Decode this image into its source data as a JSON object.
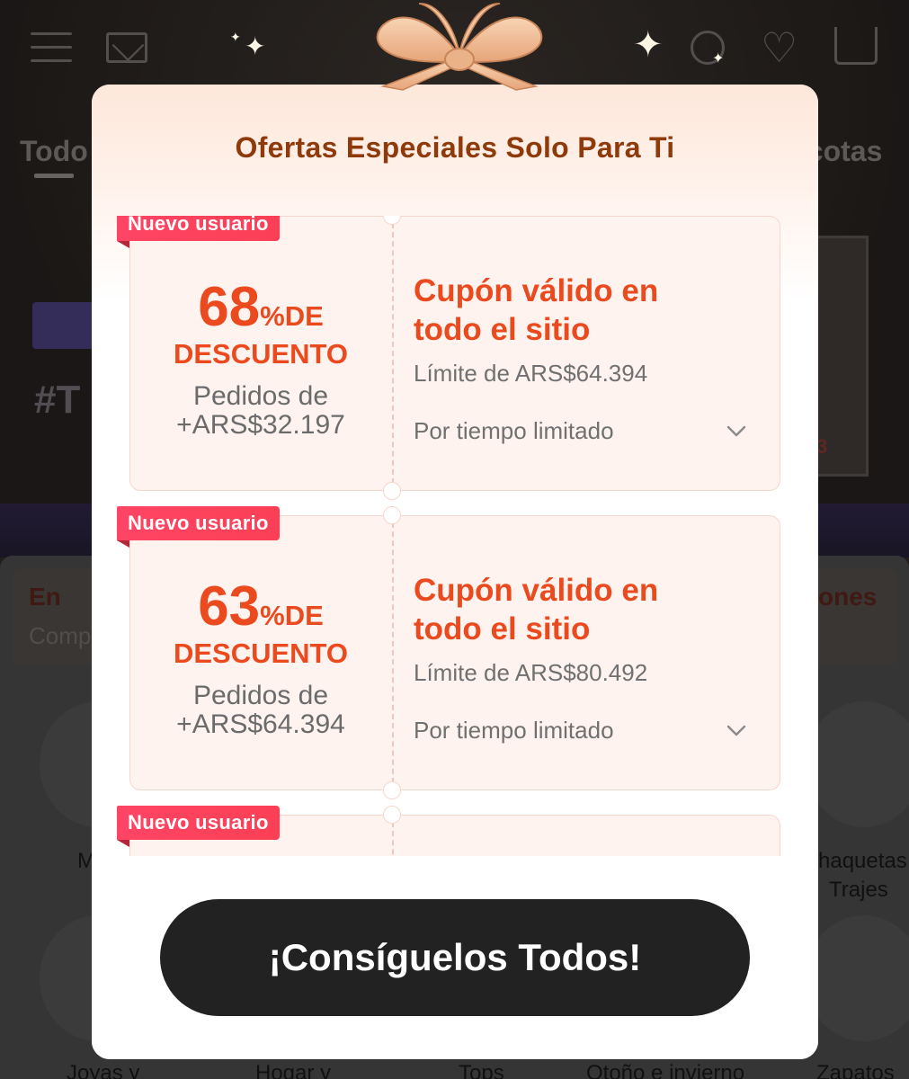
{
  "background": {
    "tabs": {
      "todo": "Todo",
      "mascotas": "scotas"
    },
    "banner_hash": "#T",
    "product_num": "3",
    "strip_left": "En",
    "strip_left_sub": "Comp",
    "strip_right": "ones",
    "categories": {
      "c1": "M",
      "c3_line1": "haquetas",
      "c3_line2": "Trajes",
      "c5": "Joyas y",
      "c6": "Hogar y",
      "c7": "Tops",
      "c8": "Otoño e invierno",
      "c9": "Zapatos"
    }
  },
  "modal": {
    "title": "Ofertas Especiales Solo Para Ti",
    "coupons": [
      {
        "badge": "Nuevo usuario",
        "percent": "68",
        "percent_suffix": "%DE",
        "discount_word": "DESCUENTO",
        "min_line1": "Pedidos de",
        "min_line2": "+ARS$32.197",
        "title_line1": "Cupón válido en",
        "title_line2": "todo el sitio",
        "limit": "Límite de ARS$64.394",
        "time": "Por tiempo limitado"
      },
      {
        "badge": "Nuevo usuario",
        "percent": "63",
        "percent_suffix": "%DE",
        "discount_word": "DESCUENTO",
        "min_line1": "Pedidos de",
        "min_line2": "+ARS$64.394",
        "title_line1": "Cupón válido en",
        "title_line2": "todo el sitio",
        "limit": "Límite de ARS$80.492",
        "time": "Por tiempo limitado"
      },
      {
        "badge": "Nuevo usuario"
      }
    ],
    "cta_label": "¡Consíguelos Todos!"
  },
  "colors": {
    "accent": "#ea4a1e",
    "title": "#8e3a0b",
    "badge": "#fb3f55",
    "cta": "#222222"
  }
}
